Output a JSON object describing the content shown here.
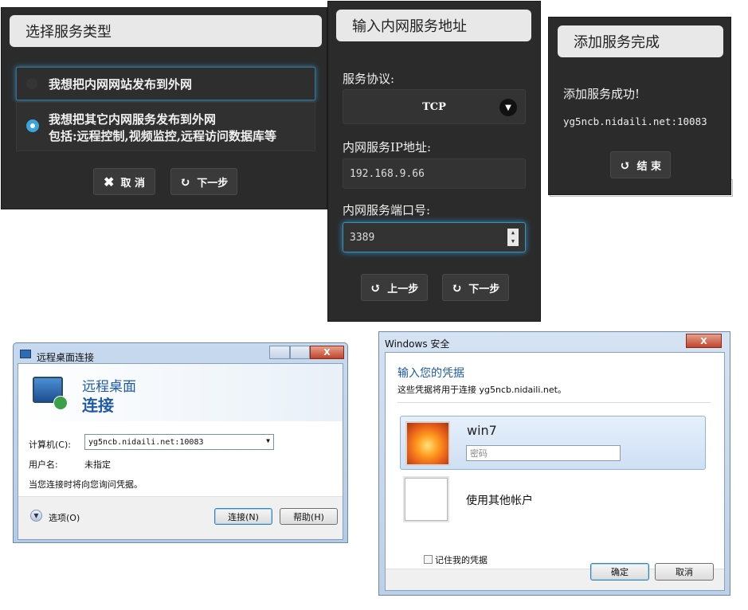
{
  "panel_select": {
    "title": "选择服务类型",
    "option1": "我想把内网网站发布到外网",
    "option2_line1": "我想把其它内网服务发布到外网",
    "option2_line2": "包括:远程控制,视频监控,远程访问数据库等",
    "cancel_label": "取 消",
    "next_label": "下一步"
  },
  "panel_address": {
    "title": "输入内网服务地址",
    "protocol_label": "服务协议:",
    "protocol_value": "TCP",
    "ip_label": "内网服务IP地址:",
    "ip_value": "192.168.9.66",
    "port_label": "内网服务端口号:",
    "port_value": "3389",
    "prev_label": "上一步",
    "next_label": "下一步"
  },
  "panel_done": {
    "title": "添加服务完成",
    "success_text": "添加服务成功!",
    "address": "yg5ncb.nidaili.net:10083",
    "finish_label": "结 束"
  },
  "rdp_dialog": {
    "window_title": "远程桌面连接",
    "heading_line1": "远程桌面",
    "heading_line2": "连接",
    "computer_label": "计算机(C):",
    "computer_value": "yg5ncb.nidaili.net:10083",
    "user_label": "用户名:",
    "user_value": "未指定",
    "hint": "当您连接时将向您询问凭据。",
    "options_label": "选项(O)",
    "connect_label": "连接(N)",
    "help_label": "帮助(H)",
    "close_glyph": "X"
  },
  "security_dialog": {
    "window_title": "Windows 安全",
    "heading": "输入您的凭据",
    "subtitle": "这些凭据将用于连接 yg5ncb.nidaili.net。",
    "account_name": "win7",
    "password_placeholder": "密码",
    "other_account": "使用其他帐户",
    "remember_label": "记住我的凭据",
    "ok_label": "确定",
    "cancel_label": "取消",
    "close_glyph": "X"
  }
}
